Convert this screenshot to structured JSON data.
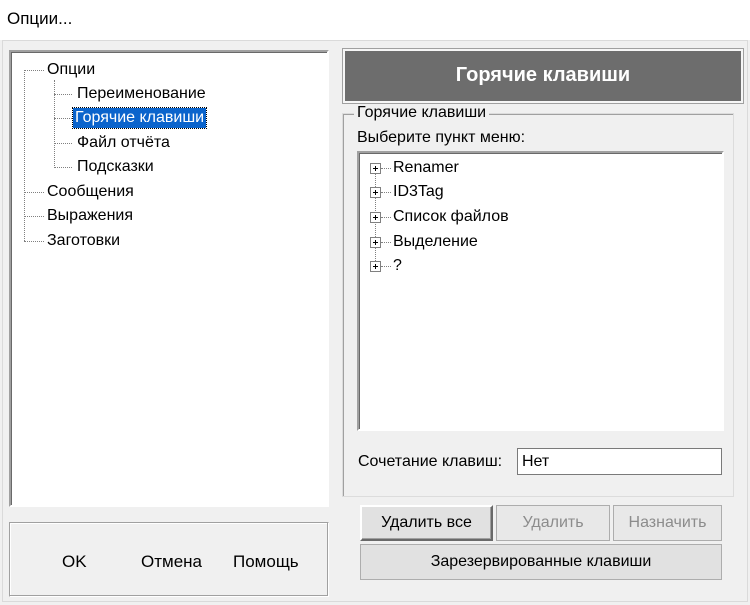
{
  "window": {
    "title": "Опции..."
  },
  "nav_tree": {
    "root": "Опции",
    "children": [
      "Переименование",
      "Горячие клавиши",
      "Файл отчёта",
      "Подсказки"
    ],
    "siblings": [
      "Сообщения",
      "Выражения",
      "Заготовки"
    ],
    "selected": "Горячие клавиши"
  },
  "dialog_buttons": {
    "ok": "OK",
    "cancel": "Отмена",
    "help": "Помощь"
  },
  "panel": {
    "header": "Горячие клавиши",
    "group_title": "Горячие клавиши",
    "menu_prompt": "Выберите пункт меню:",
    "menu_items": [
      "Renamer",
      "ID3Tag",
      "Список файлов",
      "Выделение",
      "?"
    ],
    "shortcut_label": "Сочетание клавиш:",
    "shortcut_value": "Нет"
  },
  "actions": {
    "delete_all": "Удалить все",
    "delete": "Удалить",
    "assign": "Назначить",
    "reserved": "Зарезервированные клавиши"
  },
  "colors": {
    "header_bg": "#6d6d6d",
    "selection": "#0b64cc"
  }
}
